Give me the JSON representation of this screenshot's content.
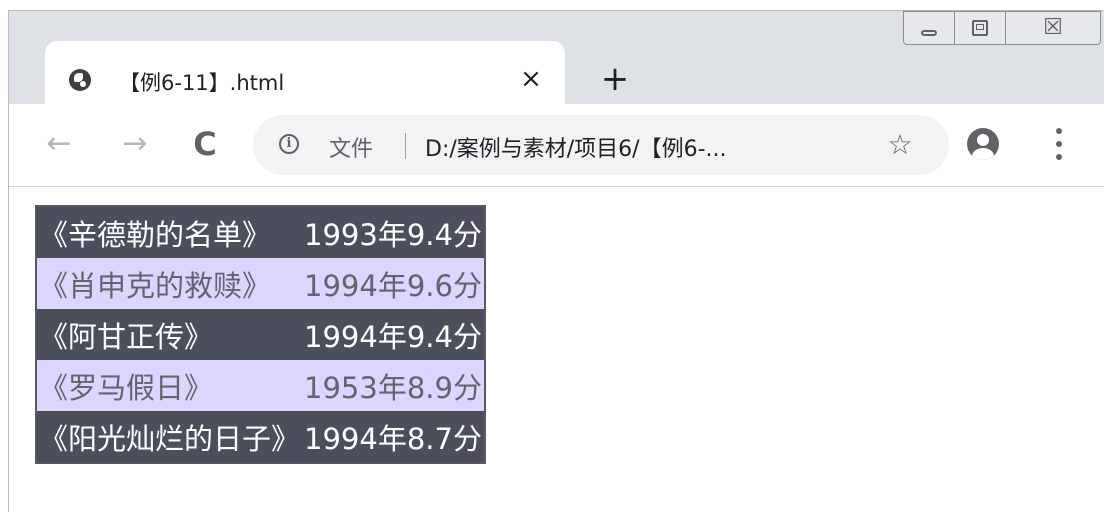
{
  "browser": {
    "tab": {
      "title": "【例6-11】.html",
      "close_label": "×"
    },
    "new_tab_label": "+",
    "window_controls": {
      "close_label": "☒"
    },
    "toolbar": {
      "back_label": "←",
      "forward_label": "→",
      "reload_label": "C",
      "omnibox": {
        "info_label": "i",
        "file_label": "文件",
        "url": "D:/案例与素材/项目6/【例6-...",
        "star_label": "☆"
      }
    }
  },
  "colors": {
    "dark_row": "#4a4f5b",
    "light_row": "#dcd6ff",
    "dark_text": "#ffffff",
    "light_text": "#62656c"
  },
  "movies": [
    {
      "title": "《辛德勒的名单》",
      "info": "1993年9.4分"
    },
    {
      "title": "《肖申克的救赎》",
      "info": "1994年9.6分"
    },
    {
      "title": "《阿甘正传》",
      "info": "1994年9.4分"
    },
    {
      "title": "《罗马假日》",
      "info": "1953年8.9分"
    },
    {
      "title": "《阳光灿烂的日子》",
      "info": "1994年8.7分"
    }
  ]
}
